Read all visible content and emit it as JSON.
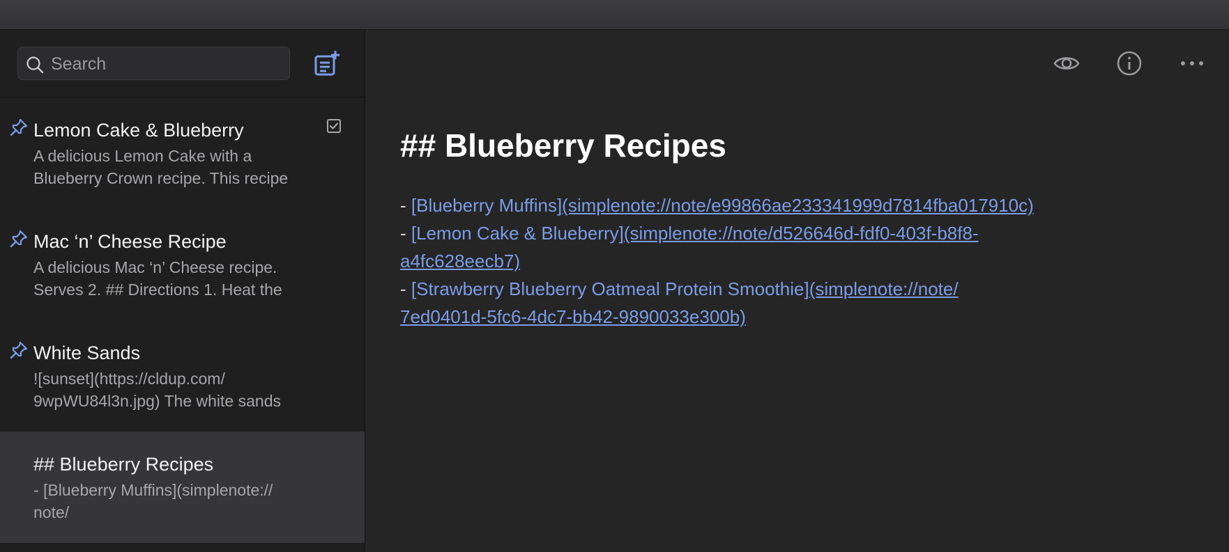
{
  "sidebar": {
    "search": {
      "placeholder": "Search",
      "value": ""
    },
    "notes": [
      {
        "title": "Lemon Cake & Blueberry",
        "preview_line1": "A delicious Lemon Cake with a",
        "preview_line2": "Blueberry Crown recipe. This recipe",
        "pinned": true,
        "has_checklist": true
      },
      {
        "title": "Mac ‘n’ Cheese Recipe",
        "preview_line1": "A delicious Mac ‘n’ Cheese recipe.",
        "preview_line2": "Serves 2. ## Directions 1. Heat the",
        "pinned": true
      },
      {
        "title": "White Sands",
        "preview_line1": "![sunset](https://cldup.com/",
        "preview_line2": "9wpWU84l3n.jpg) The white sands",
        "pinned": true
      },
      {
        "title": "## Blueberry Recipes",
        "preview_line1": "- [Blueberry Muffins](simplenote://",
        "preview_line2": "note/",
        "pinned": false,
        "selected": true
      }
    ]
  },
  "toolbar": {
    "icons": [
      "preview-eye-icon",
      "info-icon",
      "more-options-icon"
    ]
  },
  "editor": {
    "heading": "## Blueberry Recipes",
    "links": [
      {
        "dash": "- ",
        "text": "[Blueberry Muffins]",
        "url_part1": "(simplenote://note/e99866ae233341999d7814fba017910c)",
        "url_part2": ""
      },
      {
        "dash": "- ",
        "text": "[Lemon Cake & Blueberry]",
        "url_part1": "(simplenote://note/d526646d-fdf0-403f-b8f8-",
        "url_part2": "a4fc628eecb7)"
      },
      {
        "dash": "- ",
        "text": "[Strawberry Blueberry Oatmeal Protein Smoothie]",
        "url_part1": "(simplenote://note/",
        "url_part2": "7ed0401d-5fc6-4dc7-bb42-9890033e300b)"
      }
    ]
  },
  "colors": {
    "accent": "#7b9de6",
    "background": "#1e1e1f",
    "editor_background": "#252526",
    "selected_note": "#363638"
  }
}
